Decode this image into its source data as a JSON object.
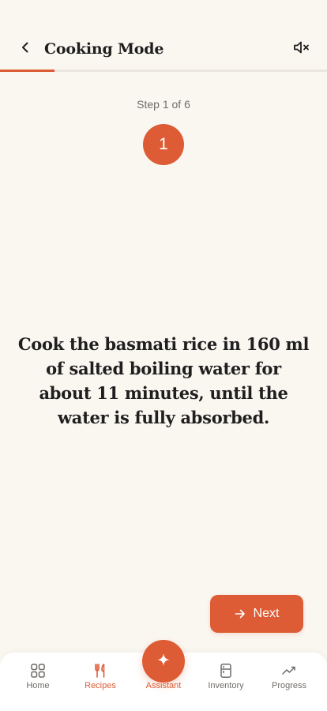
{
  "header": {
    "title": "Cooking Mode",
    "back_icon": "chevron-left-icon",
    "mute_icon": "speaker-muted-icon"
  },
  "progress": {
    "current_step": 1,
    "total_steps": 6,
    "fraction": 0.1667
  },
  "step": {
    "label": "Step 1 of 6",
    "number": "1",
    "instruction": "Cook the basmati rice in 160 ml of salted boiling water for about 11 minutes, until the water is fully absorbed."
  },
  "actions": {
    "next_label": "Next",
    "next_icon": "arrow-right-icon"
  },
  "nav": {
    "items": [
      {
        "label": "Home",
        "icon": "grid-icon",
        "active": false
      },
      {
        "label": "Recipes",
        "icon": "utensils-icon",
        "active": true
      },
      {
        "label": "Assistant",
        "icon": "sparkle-icon",
        "active": true
      },
      {
        "label": "Inventory",
        "icon": "fridge-icon",
        "active": false
      },
      {
        "label": "Progress",
        "icon": "trend-up-icon",
        "active": false
      }
    ]
  },
  "colors": {
    "accent": "#dd5c35",
    "background": "#faf7f1",
    "text": "#1f1f1f",
    "muted": "#6f6c68"
  }
}
